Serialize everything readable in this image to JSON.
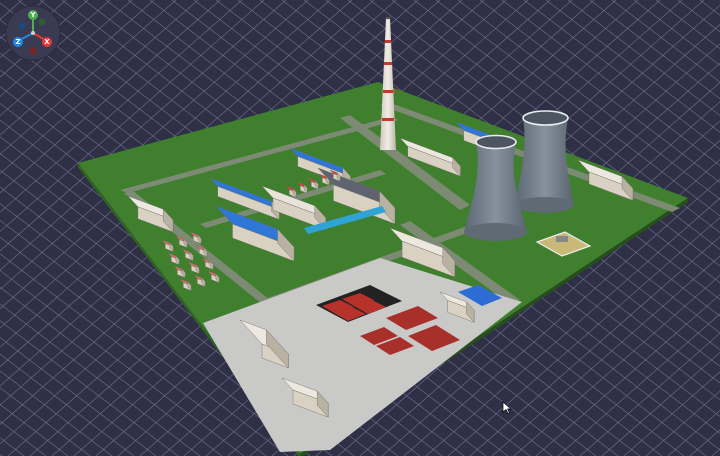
{
  "viewer": {
    "background": "#2f3046",
    "grid_color": "#6f7192"
  },
  "gizmo": {
    "axes": [
      {
        "label": "Y",
        "color": "#4caf50"
      },
      {
        "label": "X",
        "color": "#e53935"
      },
      {
        "label": "Z",
        "color": "#1e88e5"
      }
    ]
  },
  "scene": {
    "ground_color": "#3f7f2e",
    "road_color": "#7d8a74",
    "plaza_color": "#c9c9c7",
    "roof_blue": "#2e77d6",
    "court_red": "#b8322c",
    "tower_color": "#6f7b87"
  },
  "cursor_icon": "arrow-cursor-icon"
}
